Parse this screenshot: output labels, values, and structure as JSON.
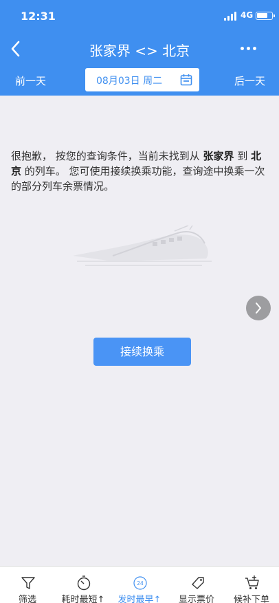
{
  "status_bar": {
    "time": "12:31",
    "network": "4G"
  },
  "nav": {
    "title": "张家界 <> 北京"
  },
  "date_bar": {
    "prev_label": "前一天",
    "date": "08月03日 周二",
    "next_label": "后一天"
  },
  "message": {
    "part1": "很抱歉， 按您的查询条件，当前未找到从 ",
    "from": "张家界",
    "part2": " 到 ",
    "to": "北京",
    "part3": " 的列车。 您可使用接续换乘功能，查询途中换乘一次的部分列车余票情况。"
  },
  "transfer_button": "接续换乘",
  "tabbar": {
    "filter": "筛选",
    "duration": "耗时最短↑",
    "departure": "发时最早↑",
    "show_price": "显示票价",
    "waitlist": "候补下单",
    "departure_icon_text": "24"
  },
  "colors": {
    "primary": "#3f8ff0",
    "background": "#efeef3"
  }
}
